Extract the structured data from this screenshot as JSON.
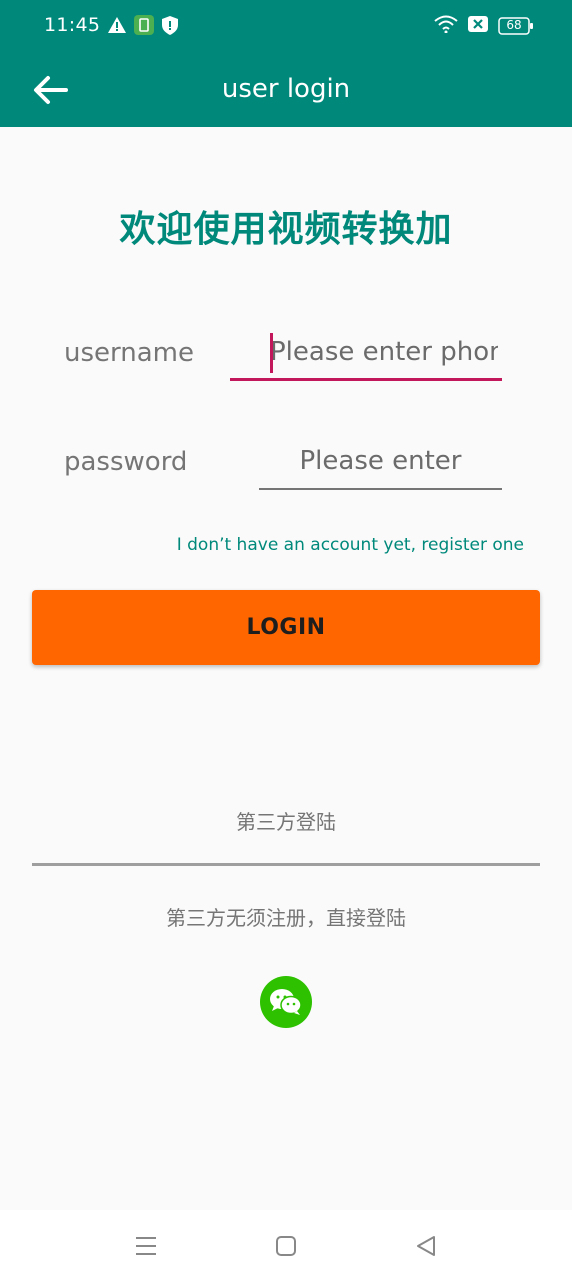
{
  "status_bar": {
    "time": "11:45",
    "battery": "68",
    "icons": [
      "warning-icon",
      "notification-app-icon",
      "shield-icon",
      "wifi-icon",
      "sim-off-icon",
      "battery-icon"
    ]
  },
  "app_bar": {
    "title": "user login",
    "back_icon": "arrow-back-icon"
  },
  "welcome_text": "欢迎使用视频转换加",
  "form": {
    "username_label": "username",
    "username_placeholder": "Please enter phone",
    "username_value": "",
    "password_label": "password",
    "password_placeholder": "Please enter",
    "password_value": "",
    "register_link": "I don’t have an account yet, register one",
    "login_label": "LOGIN"
  },
  "third_party": {
    "title": "第三方登陆",
    "subtitle": "第三方无须注册，直接登陆",
    "wechat_icon": "wechat-icon"
  },
  "colors": {
    "primary": "#00897b",
    "accent": "#c2185b",
    "login_button": "#ff6600",
    "wechat": "#2dc100"
  },
  "nav_bar": {
    "icons": [
      "menu-icon",
      "home-icon",
      "back-icon"
    ]
  }
}
